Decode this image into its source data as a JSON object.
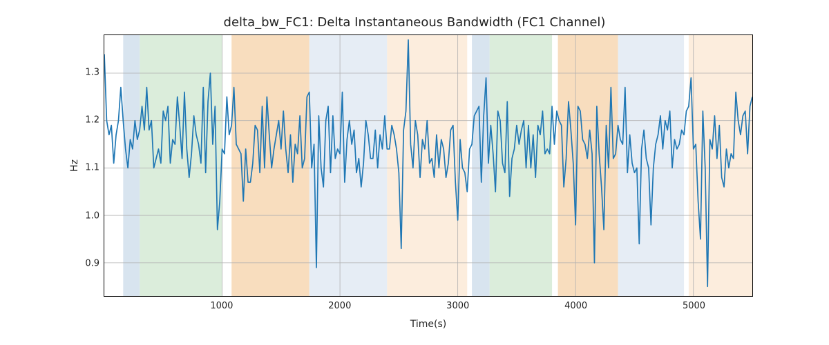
{
  "chart_data": {
    "type": "line",
    "title": "delta_bw_FC1: Delta Instantaneous Bandwidth (FC1 Channel)",
    "xlabel": "Time(s)",
    "ylabel": "Hz",
    "xlim": [
      0,
      5500
    ],
    "ylim": [
      0.83,
      1.38
    ],
    "xticks": [
      1000,
      2000,
      3000,
      4000,
      5000
    ],
    "yticks": [
      0.9,
      1.0,
      1.1,
      1.2,
      1.3
    ],
    "line_color": "#1f77b4",
    "grid_color": "#b0b0b0",
    "regions": [
      {
        "x0": 160,
        "x1": 300,
        "color": "#c7d8e8"
      },
      {
        "x0": 300,
        "x1": 1000,
        "color": "#cce5cc"
      },
      {
        "x0": 1080,
        "x1": 1740,
        "color": "#f5cfa3"
      },
      {
        "x0": 1740,
        "x1": 2400,
        "color": "#dbe5f1"
      },
      {
        "x0": 2400,
        "x1": 3080,
        "color": "#fbe6cf"
      },
      {
        "x0": 3120,
        "x1": 3270,
        "color": "#c7d8e8"
      },
      {
        "x0": 3270,
        "x1": 3800,
        "color": "#cce5cc"
      },
      {
        "x0": 3850,
        "x1": 4360,
        "color": "#f5cfa3"
      },
      {
        "x0": 4360,
        "x1": 4920,
        "color": "#dbe5f1"
      },
      {
        "x0": 4960,
        "x1": 5500,
        "color": "#fbe6cf"
      }
    ],
    "x": [
      0,
      20,
      40,
      60,
      80,
      100,
      120,
      140,
      160,
      180,
      200,
      220,
      240,
      260,
      280,
      300,
      320,
      340,
      360,
      380,
      400,
      420,
      440,
      460,
      480,
      500,
      520,
      540,
      560,
      580,
      600,
      620,
      640,
      660,
      680,
      700,
      720,
      740,
      760,
      780,
      800,
      820,
      840,
      860,
      880,
      900,
      920,
      940,
      960,
      980,
      1000,
      1020,
      1040,
      1060,
      1080,
      1100,
      1120,
      1140,
      1160,
      1180,
      1200,
      1220,
      1240,
      1260,
      1280,
      1300,
      1320,
      1340,
      1360,
      1380,
      1400,
      1420,
      1440,
      1460,
      1480,
      1500,
      1520,
      1540,
      1560,
      1580,
      1600,
      1620,
      1640,
      1660,
      1680,
      1700,
      1720,
      1740,
      1760,
      1780,
      1800,
      1820,
      1840,
      1860,
      1880,
      1900,
      1920,
      1940,
      1960,
      1980,
      2000,
      2020,
      2040,
      2060,
      2080,
      2100,
      2120,
      2140,
      2160,
      2180,
      2200,
      2220,
      2240,
      2260,
      2280,
      2300,
      2320,
      2340,
      2360,
      2380,
      2400,
      2420,
      2440,
      2460,
      2480,
      2500,
      2520,
      2540,
      2560,
      2580,
      2600,
      2620,
      2640,
      2660,
      2680,
      2700,
      2720,
      2740,
      2760,
      2780,
      2800,
      2820,
      2840,
      2860,
      2880,
      2900,
      2920,
      2940,
      2960,
      2980,
      3000,
      3020,
      3040,
      3060,
      3080,
      3100,
      3120,
      3140,
      3160,
      3180,
      3200,
      3220,
      3240,
      3260,
      3280,
      3300,
      3320,
      3340,
      3360,
      3380,
      3400,
      3420,
      3440,
      3460,
      3480,
      3500,
      3520,
      3540,
      3560,
      3580,
      3600,
      3620,
      3640,
      3660,
      3680,
      3700,
      3720,
      3740,
      3760,
      3780,
      3800,
      3820,
      3840,
      3860,
      3880,
      3900,
      3920,
      3940,
      3960,
      3980,
      4000,
      4020,
      4040,
      4060,
      4080,
      4100,
      4120,
      4140,
      4160,
      4180,
      4200,
      4220,
      4240,
      4260,
      4280,
      4300,
      4320,
      4340,
      4360,
      4380,
      4400,
      4420,
      4440,
      4460,
      4480,
      4500,
      4520,
      4540,
      4560,
      4580,
      4600,
      4620,
      4640,
      4660,
      4680,
      4700,
      4720,
      4740,
      4760,
      4780,
      4800,
      4820,
      4840,
      4860,
      4880,
      4900,
      4920,
      4940,
      4960,
      4980,
      5000,
      5020,
      5040,
      5060,
      5080,
      5100,
      5120,
      5140,
      5160,
      5180,
      5200,
      5220,
      5240,
      5260,
      5280,
      5300,
      5320,
      5340,
      5360,
      5380,
      5400,
      5420,
      5440,
      5460,
      5480,
      5500
    ],
    "values": [
      1.34,
      1.2,
      1.17,
      1.19,
      1.11,
      1.17,
      1.2,
      1.27,
      1.2,
      1.14,
      1.1,
      1.16,
      1.14,
      1.2,
      1.16,
      1.18,
      1.23,
      1.18,
      1.27,
      1.18,
      1.2,
      1.1,
      1.12,
      1.14,
      1.11,
      1.22,
      1.2,
      1.23,
      1.11,
      1.16,
      1.15,
      1.25,
      1.19,
      1.12,
      1.26,
      1.14,
      1.08,
      1.13,
      1.21,
      1.17,
      1.15,
      1.11,
      1.27,
      1.09,
      1.24,
      1.3,
      1.15,
      1.23,
      0.97,
      1.03,
      1.14,
      1.13,
      1.25,
      1.17,
      1.19,
      1.27,
      1.15,
      1.14,
      1.13,
      1.03,
      1.14,
      1.07,
      1.07,
      1.11,
      1.19,
      1.18,
      1.09,
      1.23,
      1.1,
      1.25,
      1.17,
      1.1,
      1.14,
      1.17,
      1.2,
      1.14,
      1.22,
      1.14,
      1.09,
      1.17,
      1.07,
      1.15,
      1.13,
      1.21,
      1.1,
      1.12,
      1.25,
      1.26,
      1.1,
      1.15,
      0.89,
      1.21,
      1.1,
      1.06,
      1.2,
      1.23,
      1.09,
      1.21,
      1.12,
      1.14,
      1.13,
      1.26,
      1.07,
      1.16,
      1.2,
      1.15,
      1.18,
      1.09,
      1.12,
      1.06,
      1.11,
      1.2,
      1.17,
      1.12,
      1.12,
      1.18,
      1.1,
      1.17,
      1.14,
      1.21,
      1.14,
      1.14,
      1.19,
      1.17,
      1.14,
      1.09,
      0.93,
      1.18,
      1.22,
      1.37,
      1.15,
      1.1,
      1.2,
      1.17,
      1.08,
      1.16,
      1.14,
      1.2,
      1.11,
      1.12,
      1.08,
      1.17,
      1.1,
      1.16,
      1.14,
      1.08,
      1.11,
      1.18,
      1.19,
      1.07,
      0.99,
      1.16,
      1.1,
      1.09,
      1.05,
      1.14,
      1.15,
      1.21,
      1.22,
      1.23,
      1.07,
      1.21,
      1.29,
      1.11,
      1.19,
      1.13,
      1.05,
      1.22,
      1.2,
      1.11,
      1.09,
      1.24,
      1.04,
      1.12,
      1.14,
      1.19,
      1.15,
      1.18,
      1.2,
      1.1,
      1.19,
      1.1,
      1.17,
      1.08,
      1.19,
      1.17,
      1.22,
      1.13,
      1.14,
      1.13,
      1.23,
      1.15,
      1.22,
      1.2,
      1.19,
      1.06,
      1.12,
      1.24,
      1.18,
      1.11,
      0.98,
      1.23,
      1.22,
      1.16,
      1.15,
      1.12,
      1.18,
      1.13,
      0.9,
      1.23,
      1.13,
      1.06,
      0.97,
      1.19,
      1.1,
      1.27,
      1.12,
      1.13,
      1.19,
      1.16,
      1.15,
      1.27,
      1.09,
      1.17,
      1.11,
      1.09,
      1.1,
      0.94,
      1.14,
      1.18,
      1.12,
      1.1,
      0.98,
      1.1,
      1.15,
      1.17,
      1.21,
      1.14,
      1.2,
      1.18,
      1.22,
      1.1,
      1.16,
      1.14,
      1.15,
      1.18,
      1.17,
      1.22,
      1.23,
      1.29,
      1.14,
      1.15,
      1.03,
      0.95,
      1.22,
      1.1,
      0.85,
      1.16,
      1.14,
      1.21,
      1.12,
      1.19,
      1.08,
      1.06,
      1.14,
      1.1,
      1.13,
      1.12,
      1.26,
      1.2,
      1.17,
      1.21,
      1.22,
      1.13,
      1.23,
      1.25
    ]
  }
}
